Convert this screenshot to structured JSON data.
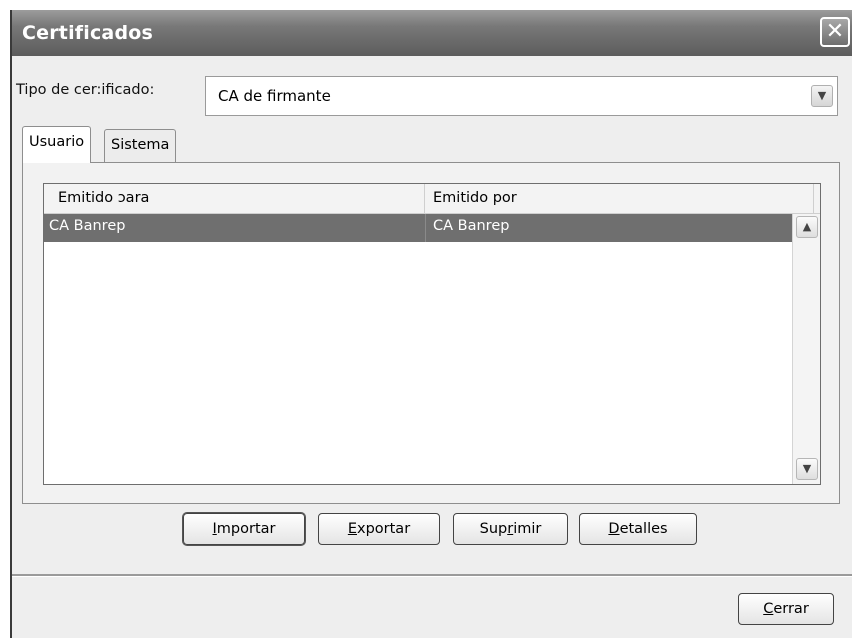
{
  "window": {
    "title": "Certificados",
    "close_glyph": "✕"
  },
  "certificate_type": {
    "label": "Tipo de cer:ificado:",
    "selected_value": "CA de firmante"
  },
  "tabs": [
    {
      "label": "Usuario",
      "active": true
    },
    {
      "label": "Sistema",
      "active": false
    }
  ],
  "list": {
    "columns": [
      "Emitido ɔara",
      "Emitido por"
    ],
    "rows": [
      {
        "issued_to": "CA Banrep",
        "issued_by": "CA Banrep",
        "selected": true
      }
    ]
  },
  "actions": {
    "import": {
      "pre": "",
      "key": "I",
      "post": "mportar"
    },
    "export": {
      "pre": "",
      "key": "E",
      "post": "xportar"
    },
    "delete": {
      "pre": "Sup",
      "key": "r",
      "post": "imir"
    },
    "details": {
      "pre": "",
      "key": "D",
      "post": "etalles"
    }
  },
  "footer": {
    "close": {
      "pre": "",
      "key": "C",
      "post": "errar"
    }
  },
  "icons": {
    "combo_arrow": "chevron-down-icon",
    "scroll_up": "chevron-up-icon",
    "scroll_down": "chevron-down-icon",
    "close": "close-icon"
  },
  "colors": {
    "titlebar": "#787878",
    "selected_row": "#6f6f6f",
    "window_bg": "#eeeeee"
  }
}
